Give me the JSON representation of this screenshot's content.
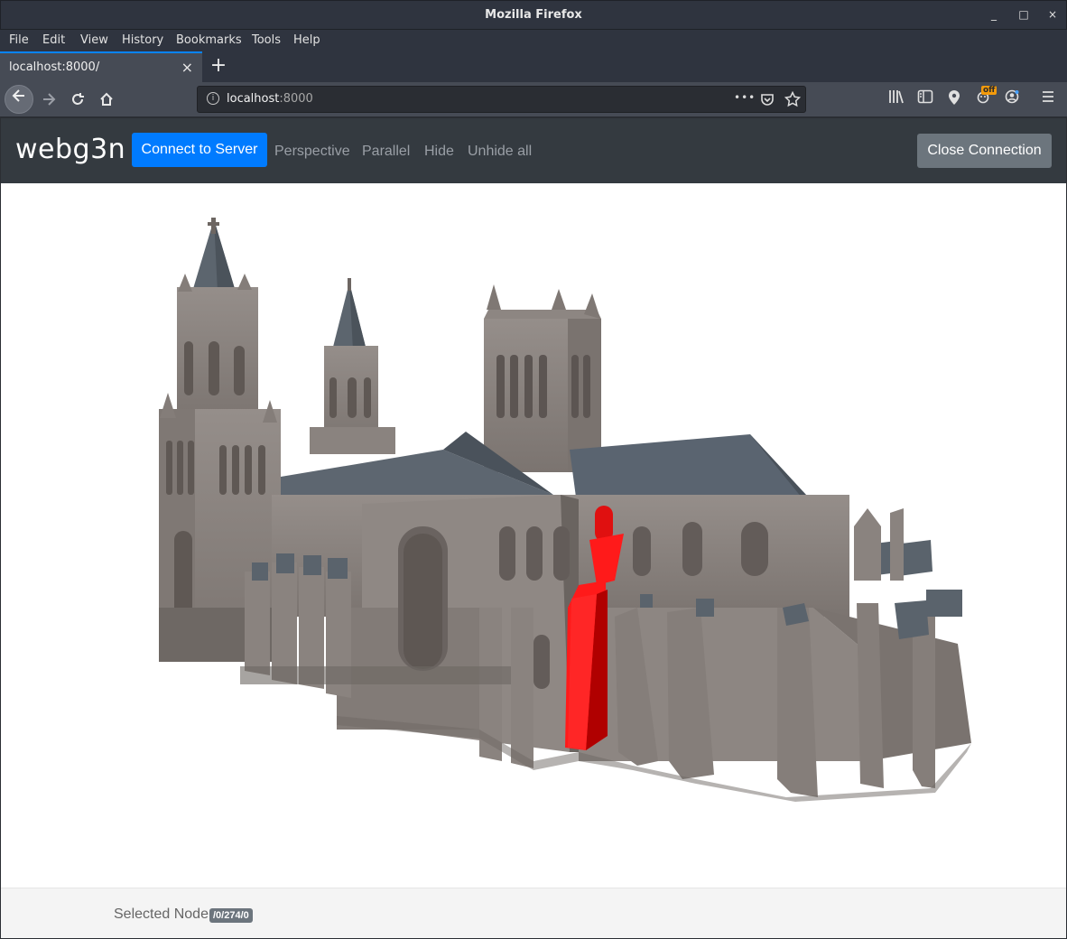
{
  "window": {
    "title": "Mozilla Firefox",
    "controls": [
      "_",
      "□",
      "×"
    ]
  },
  "menu": [
    "File",
    "Edit",
    "View",
    "History",
    "Bookmarks",
    "Tools",
    "Help"
  ],
  "tab": {
    "label": "localhost:8000/",
    "close": "×",
    "new": "+"
  },
  "nav": {
    "url_host": "localhost",
    "url_port": ":8000",
    "more": "•••"
  },
  "app": {
    "brand": "webg3n",
    "connect_label": "Connect to Server",
    "links": [
      "Perspective",
      "Parallel",
      "Hide",
      "Unhide all"
    ],
    "close_label": "Close Connection"
  },
  "footer": {
    "selected_label": "Selected Node",
    "selected_value": "/0/274/0"
  },
  "colors": {
    "accent": "#007bff",
    "secondary": "#6c757d",
    "appbar": "#343a40",
    "highlight": "#ff1a1a",
    "stone": "#8a837f",
    "roof": "#5a6470"
  },
  "icons": [
    "back-arrow-icon",
    "forward-arrow-icon",
    "reload-icon",
    "home-icon",
    "info-icon",
    "pocket-icon",
    "star-icon",
    "library-icon",
    "sidebar-icon",
    "location-icon",
    "extension-icon",
    "account-icon",
    "menu-icon"
  ]
}
